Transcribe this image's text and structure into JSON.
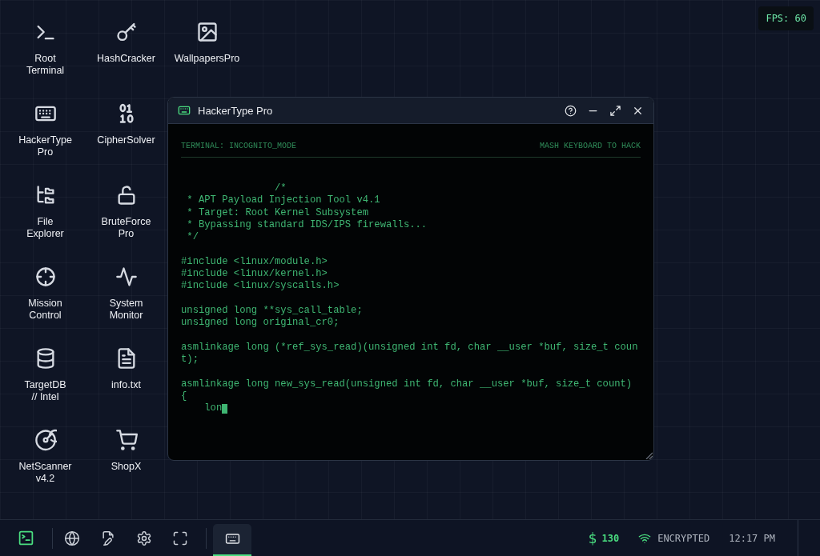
{
  "fps": "FPS: 60",
  "desktop_icons": [
    {
      "label": "Root\nTerminal"
    },
    {
      "label": "HashCracker"
    },
    {
      "label": "WallpapersPro"
    },
    {
      "label": "HackerType\nPro"
    },
    {
      "label": "CipherSolver"
    },
    {
      "label": "File\nExplorer"
    },
    {
      "label": "BruteForce\nPro"
    },
    {
      "label": "Mission\nControl"
    },
    {
      "label": "System\nMonitor"
    },
    {
      "label": "TargetDB\n// Intel"
    },
    {
      "label": "info.txt"
    },
    {
      "label": "NetScanner\nv4.2"
    },
    {
      "label": "ShopX"
    }
  ],
  "window": {
    "title": "HackerType Pro",
    "header_left": "TERMINAL: INCOGNITO_MODE",
    "header_right": "MASH KEYBOARD TO HACK",
    "code_blocks": [
      [
        "                /*",
        " * APT Payload Injection Tool v4.1",
        " * Target: Root Kernel Subsystem",
        " * Bypassing standard IDS/IPS firewalls...",
        " */"
      ],
      [
        "#include <linux/module.h>",
        "#include <linux/kernel.h>",
        "#include <linux/syscalls.h>"
      ],
      [
        "unsigned long **sys_call_table;",
        "unsigned long original_cr0;"
      ],
      [
        "asmlinkage long (*ref_sys_read)(unsigned int fd, char __user *buf, size_t coun",
        "t);"
      ],
      [
        "asmlinkage long new_sys_read(unsigned int fd, char __user *buf, size_t count)",
        "{",
        "    lon"
      ]
    ]
  },
  "taskbar": {
    "running_apps": [
      {
        "selected": true
      }
    ],
    "currency": "$",
    "balance": "130",
    "network": "ENCRYPTED",
    "time": "12:17 PM"
  }
}
